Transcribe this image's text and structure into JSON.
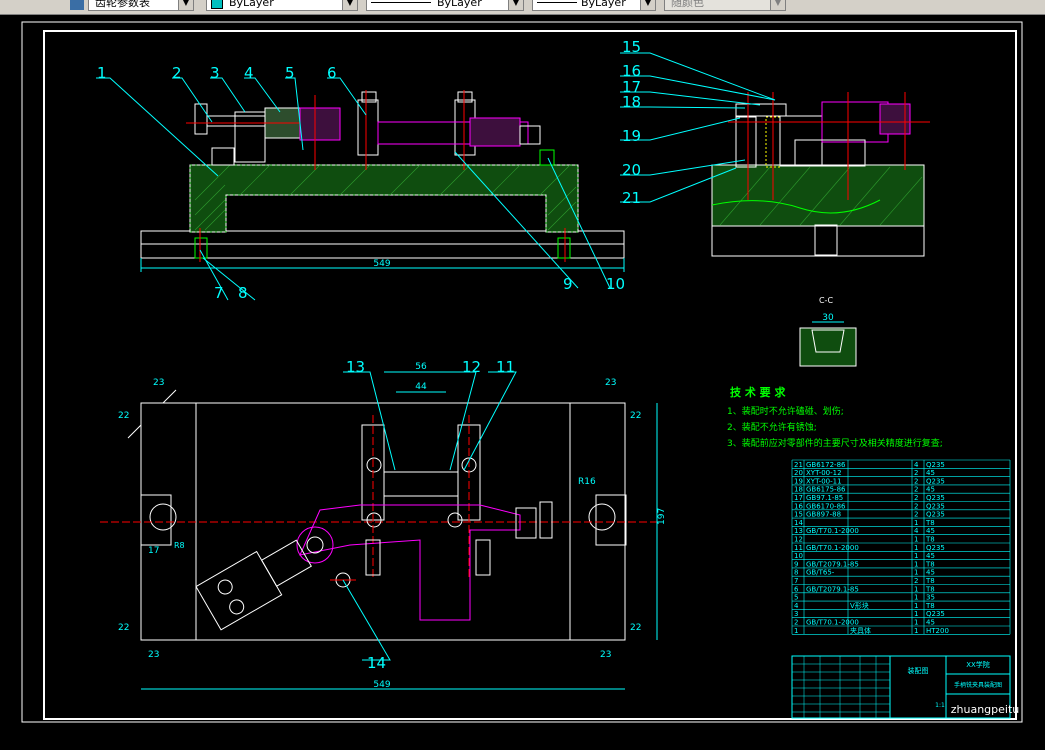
{
  "toolbar": {
    "style_value": "齿轮参数表",
    "layer_value": "ByLayer",
    "linetype_value": "ByLayer",
    "lineweight_value": "ByLayer",
    "plotstyle_value": "随颜色"
  },
  "drawing": {
    "colors": {
      "background": "#000000",
      "frame": "#ffffff",
      "part": "#ffffff",
      "hatch": "#00ff00",
      "dimension": "#00ffff",
      "center": "#ff0000",
      "workpiece": "#ff00ff",
      "annotation": "#00ff00"
    },
    "part_numbers_top": [
      "1",
      "2",
      "3",
      "4",
      "5",
      "6",
      "7",
      "8",
      "9",
      "10"
    ],
    "part_numbers_right": [
      "15",
      "16",
      "17",
      "18",
      "19",
      "20",
      "21"
    ],
    "part_numbers_plan": [
      "11",
      "12",
      "13",
      "14"
    ],
    "dimensions": {
      "top_length": "549",
      "bottom_length": "549",
      "width_56": "56",
      "width_44": "44",
      "dim_23": "23",
      "dim_22": "22",
      "dim_197": "197",
      "dim_17": "17",
      "dim_30": "30",
      "r16": "R16",
      "r8": "R8",
      "section_cc": "C-C"
    },
    "tech_requirements": {
      "title": "技 术 要 求",
      "items": [
        "1、装配时不允许磕碰、划伤;",
        "2、装配不允许有锈蚀;",
        "3、装配前应对零部件的主要尺寸及相关精度进行复查;"
      ]
    },
    "bom": [
      {
        "no": "21",
        "code": "GB6172-86",
        "name": "",
        "qty": "4",
        "mat": "Q235"
      },
      {
        "no": "20",
        "code": "XYT-00-12",
        "name": "",
        "qty": "2",
        "mat": "45"
      },
      {
        "no": "19",
        "code": "XYT-00-11",
        "name": "",
        "qty": "2",
        "mat": "Q235"
      },
      {
        "no": "18",
        "code": "GB6175-86",
        "name": "",
        "qty": "2",
        "mat": "45"
      },
      {
        "no": "17",
        "code": "GB97.1-85",
        "name": "",
        "qty": "2",
        "mat": "Q235"
      },
      {
        "no": "16",
        "code": "GB6170-86",
        "name": "",
        "qty": "2",
        "mat": "Q235"
      },
      {
        "no": "15",
        "code": "GB897-88",
        "name": "",
        "qty": "2",
        "mat": "Q235"
      },
      {
        "no": "14",
        "code": "",
        "name": "",
        "qty": "1",
        "mat": "T8"
      },
      {
        "no": "13",
        "code": "GB/T70.1-2000",
        "name": "",
        "qty": "4",
        "mat": "45"
      },
      {
        "no": "12",
        "code": "",
        "name": "",
        "qty": "1",
        "mat": "T8"
      },
      {
        "no": "11",
        "code": "GB/T70.1-2000",
        "name": "",
        "qty": "1",
        "mat": "Q235"
      },
      {
        "no": "10",
        "code": "",
        "name": "",
        "qty": "1",
        "mat": "45"
      },
      {
        "no": "9",
        "code": "GB/T2079.1-85",
        "name": "",
        "qty": "1",
        "mat": "T8"
      },
      {
        "no": "8",
        "code": "GB/T65-",
        "name": "",
        "qty": "1",
        "mat": "45"
      },
      {
        "no": "7",
        "code": "",
        "name": "",
        "qty": "2",
        "mat": "T8"
      },
      {
        "no": "6",
        "code": "GB/T2079.1-85",
        "name": "",
        "qty": "1",
        "mat": "T8"
      },
      {
        "no": "5",
        "code": "",
        "name": "",
        "qty": "1",
        "mat": "35"
      },
      {
        "no": "4",
        "code": "",
        "name": "V形块",
        "qty": "1",
        "mat": "T8"
      },
      {
        "no": "3",
        "code": "",
        "name": "",
        "qty": "1",
        "mat": "Q235"
      },
      {
        "no": "2",
        "code": "GB/T70.1-2000",
        "name": "",
        "qty": "1",
        "mat": "45"
      },
      {
        "no": "1",
        "code": "",
        "name": "夹具体",
        "qty": "1",
        "mat": "HT200"
      }
    ],
    "title_block": {
      "drawing_title": "手柄铣夹具装配图",
      "company": "XX学院",
      "sheet": "装配图",
      "scale": "1:1",
      "watermark": "zhuangpeitu"
    }
  }
}
